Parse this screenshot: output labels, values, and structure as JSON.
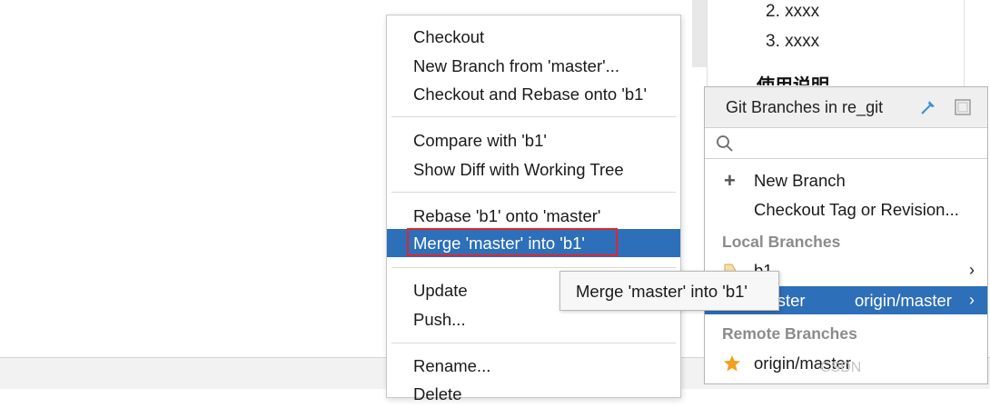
{
  "background_doc": {
    "items": [
      "2. xxxx",
      "3. xxxx"
    ],
    "partial_heading": "使用说明"
  },
  "context_menu": {
    "items": [
      {
        "label": "Checkout"
      },
      {
        "label": "New Branch from 'master'..."
      },
      {
        "label": "Checkout and Rebase onto 'b1'"
      },
      {
        "label": "Compare with 'b1'"
      },
      {
        "label": "Show Diff with Working Tree"
      },
      {
        "label": "Rebase 'b1' onto 'master'"
      },
      {
        "label": "Merge 'master' into 'b1'",
        "selected": true
      },
      {
        "label": "Update"
      },
      {
        "label": "Push..."
      },
      {
        "label": "Rename..."
      },
      {
        "label": "Delete"
      }
    ]
  },
  "tooltip": {
    "text": "Merge 'master' into 'b1'"
  },
  "git_branches": {
    "title": "Git Branches in re_git",
    "search_placeholder": "",
    "actions": [
      {
        "label": "New Branch",
        "icon": "plus-icon"
      },
      {
        "label": "Checkout Tag or Revision..."
      }
    ],
    "local_header": "Local Branches",
    "local": [
      {
        "name": "b1",
        "icon": "tag-icon"
      },
      {
        "name": "master",
        "tracking": "origin/master",
        "selected": true
      }
    ],
    "remote_header": "Remote Branches",
    "remote": [
      {
        "name": "origin/master",
        "icon": "star-icon"
      }
    ]
  },
  "watermark": "CSDN",
  "colors": {
    "selection": "#2d6fb8",
    "highlight_box": "#e0262b",
    "star": "#f0a020"
  }
}
